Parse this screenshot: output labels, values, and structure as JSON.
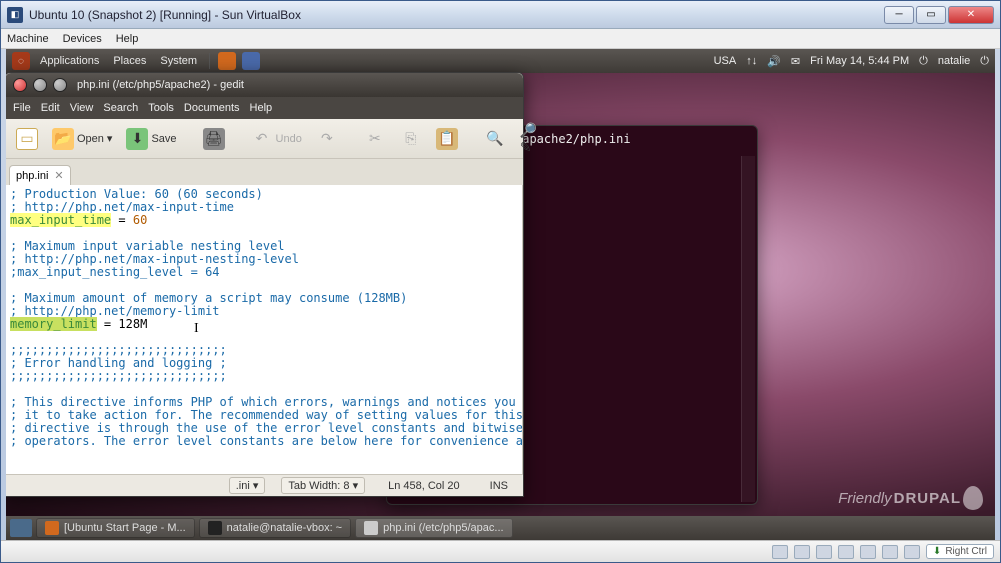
{
  "vbox": {
    "title": "Ubuntu 10 (Snapshot 2) [Running] - Sun VirtualBox",
    "menu": [
      "Machine",
      "Devices",
      "Help"
    ],
    "host_key": "Right Ctrl"
  },
  "gnome_top": {
    "menus": [
      "Applications",
      "Places",
      "System"
    ],
    "indicator_text": "USA",
    "datetime": "Fri May 14,  5:44 PM",
    "user": "natalie"
  },
  "terminal": {
    "visible_line": "/apache2/php.ini"
  },
  "gedit": {
    "title": "php.ini (/etc/php5/apache2) - gedit",
    "menu": [
      "File",
      "Edit",
      "View",
      "Search",
      "Tools",
      "Documents",
      "Help"
    ],
    "toolbar": {
      "open": "Open",
      "save": "Save",
      "undo": "Undo"
    },
    "tab": "php.ini",
    "status": {
      "lang": ".ini ▾",
      "tabwidth": "Tab Width: 8 ▾",
      "cursor": "Ln 458, Col 20",
      "mode": "INS"
    },
    "code": {
      "l1": "; Production Value: 60 (60 seconds)",
      "l2": "; http://php.net/max-input-time",
      "l3k": "max_input_time",
      "l3eq": " = ",
      "l3v": "60",
      "l5": "; Maximum input variable nesting level",
      "l6": "; http://php.net/max-input-nesting-level",
      "l7": ";max_input_nesting_level = 64",
      "l9": "; Maximum amount of memory a script may consume (128MB)",
      "l10": "; http://php.net/memory-limit",
      "l11k": "memory_limit",
      "l11eq": " = ",
      "l11v": "128M",
      "l13": ";;;;;;;;;;;;;;;;;;;;;;;;;;;;;;",
      "l14": "; Error handling and logging ;",
      "l15": ";;;;;;;;;;;;;;;;;;;;;;;;;;;;;;",
      "l17": "; This directive informs PHP of which errors, warnings and notices you would like",
      "l18": "; it to take action for. The recommended way of setting values for this",
      "l19": "; directive is through the use of the error level constants and bitwise",
      "l20": "; operators. The error level constants are below here for convenience as well as"
    }
  },
  "gnome_bottom": {
    "tasks": [
      "[Ubuntu Start Page - M...",
      "natalie@natalie-vbox: ~",
      "php.ini (/etc/php5/apac..."
    ]
  },
  "watermark": {
    "text1": "Friendly",
    "text2": "DRUPAL"
  }
}
